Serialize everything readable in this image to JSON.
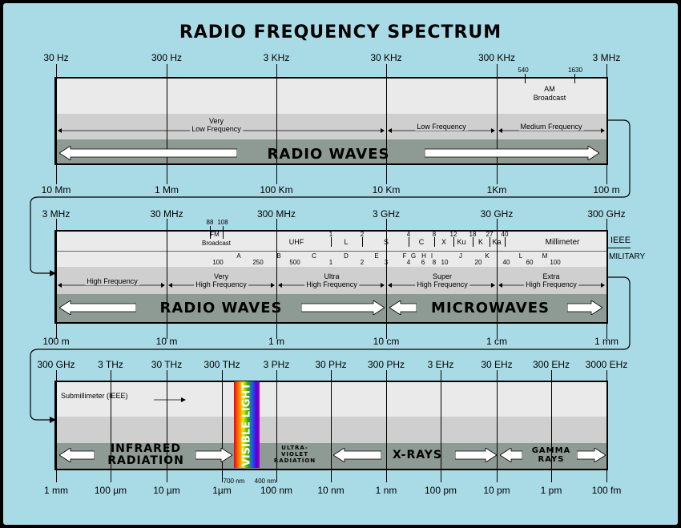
{
  "title": "RADIO FREQUENCY SPECTRUM",
  "row1": {
    "freq_labels": [
      "30 Hz",
      "300 Hz",
      "3 KHz",
      "30 KHz",
      "300 KHz",
      "3 MHz"
    ],
    "wave_labels": [
      "10 Mm",
      "1 Mm",
      "100 Km",
      "10 Km",
      "1Km",
      "100 m"
    ],
    "am_start": "540",
    "am_end": "1630",
    "am_label_1": "AM",
    "am_label_2": "Broadcast",
    "ranges": [
      {
        "l1": "Very",
        "l2": "Low Frequency"
      },
      {
        "l1": "Low Frequency",
        "l2": ""
      },
      {
        "l1": "Medium Frequency",
        "l2": ""
      }
    ],
    "band_name": "RADIO WAVES"
  },
  "row2": {
    "freq_labels": [
      "3 MHz",
      "30 MHz",
      "300 MHz",
      "3 GHz",
      "30 GHz",
      "300 GHz"
    ],
    "wave_labels": [
      "100 m",
      "10 m",
      "1 m",
      "10 cm",
      "1 cm",
      "1 mm"
    ],
    "fm_nums": [
      "88",
      "108"
    ],
    "fm_label": "FM",
    "fm_broadcast": "Broadcast",
    "ieee_label": "IEEE",
    "military_label": "MILITARY",
    "ieee_nums": [
      "1",
      "2",
      "4",
      "8",
      "12",
      "18",
      "27",
      "40"
    ],
    "ieee_bands": [
      "UHF",
      "L",
      "S",
      "C",
      "X",
      "Ku",
      "K",
      "Ka",
      "Millimeter"
    ],
    "mil_nums_top": [
      "1",
      "2",
      "3",
      "4",
      "6",
      "8",
      "10",
      "20",
      "40",
      "60",
      "100"
    ],
    "mil_nums": [
      "100",
      "250",
      "500"
    ],
    "mil_bands": [
      "A",
      "B",
      "C",
      "D",
      "E",
      "F",
      "G",
      "H",
      "I",
      "J",
      "K",
      "L",
      "M"
    ],
    "ranges": [
      {
        "l1": "High Frequency",
        "l2": ""
      },
      {
        "l1": "Very",
        "l2": "High Frequency"
      },
      {
        "l1": "Ultra",
        "l2": "High Frequency"
      },
      {
        "l1": "Super",
        "l2": "High Frequency"
      },
      {
        "l1": "Extra",
        "l2": "High Frequency"
      }
    ],
    "band_name_1": "RADIO WAVES",
    "band_name_2": "MICROWAVES"
  },
  "row3": {
    "freq_labels": [
      "300 GHz",
      "3 THz",
      "30 THz",
      "300 THz",
      "3 PHz",
      "30 PHz",
      "300 PHz",
      "3 EHz",
      "30 EHz",
      "300 EHz",
      "3000 EHz"
    ],
    "wave_labels": [
      "1 mm",
      "100 µm",
      "10 µm",
      "1µm",
      "100 nm",
      "10 nm",
      "1 nm",
      "100 pm",
      "10 pm",
      "1 pm",
      "100 fm"
    ],
    "submm_label": "Submillimeter (IEEE)",
    "nm700": "700 nm",
    "nm400": "400 nm",
    "visible_label": "VISIBLE LIGHT",
    "infrared_1": "INFRARED",
    "infrared_2": "RADIATION",
    "uv_1": "ULTRA-",
    "uv_2": "VIOLET",
    "uv_3": "RADIATION",
    "xrays": "X-RAYS",
    "gamma_1": "GAMMA",
    "gamma_2": "RAYS"
  },
  "colors": {
    "panel": "#a9dbe6",
    "band_light": "#eaeaea",
    "band_mid": "#cfcfcf",
    "band_dark": "#8e9a94"
  }
}
